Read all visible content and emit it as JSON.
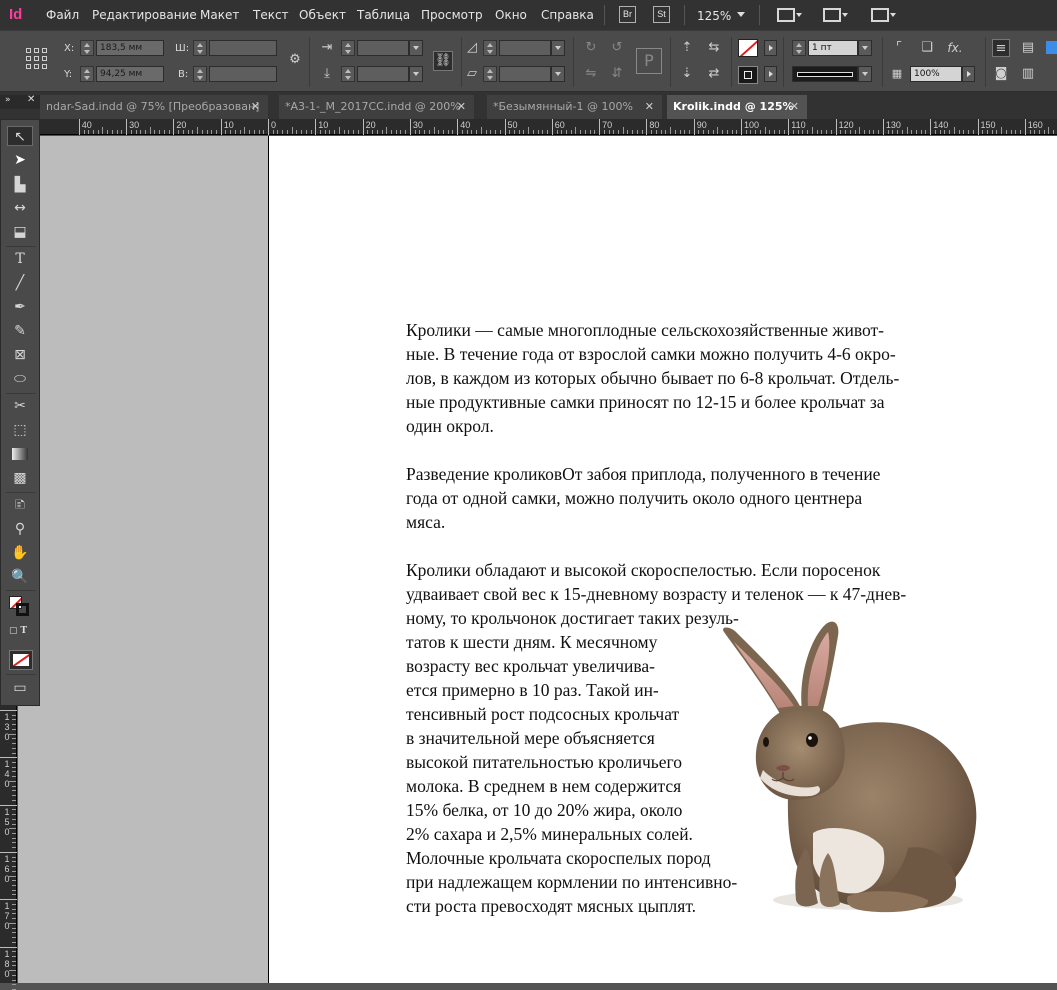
{
  "app": {
    "logo": "Id",
    "menu": [
      "Файл",
      "Редактирование",
      "Макет",
      "Текст",
      "Объект",
      "Таблица",
      "Просмотр",
      "Окно",
      "Справка"
    ],
    "bridge_label": "Br",
    "stock_label": "St",
    "zoom": "125%"
  },
  "control": {
    "x_label": "X:",
    "x_value": "183,5 мм",
    "y_label": "Y:",
    "y_value": "94,25 мм",
    "w_label": "Ш:",
    "h_label": "В:",
    "stroke_weight": "1 пт",
    "opacity": "100%",
    "fx_label": "fx."
  },
  "tabs": [
    {
      "label": "ndar-Sad.indd @ 75% [Преобразован]",
      "active": false
    },
    {
      "label": "*А3-1-_М_2017CC.indd @ 200%",
      "active": false
    },
    {
      "label": "*Безымянный-1 @ 100%",
      "active": false
    },
    {
      "label": "Krolik.indd @ 125%",
      "active": true
    }
  ],
  "ruler": {
    "horizontal": [
      "40",
      "30",
      "20",
      "10",
      "0",
      "10",
      "20",
      "30",
      "40",
      "50",
      "60",
      "70",
      "80",
      "90",
      "100",
      "110",
      "120",
      "130",
      "140",
      "150",
      "160"
    ],
    "vertical": [
      [
        "1",
        "3",
        "0"
      ],
      [
        "1",
        "4",
        "0"
      ],
      [
        "1",
        "5",
        "0"
      ],
      [
        "1",
        "6",
        "0"
      ],
      [
        "1",
        "7",
        "0"
      ],
      [
        "1",
        "8",
        "0"
      ]
    ]
  },
  "document": {
    "paragraph1": [
      "Кролики — самые многоплодные сельскохозяйственные живот-",
      "ные. В течение года от взрослой самки можно получить 4-6 окро-",
      "лов, в каждом из которых обычно бывает по 6-8 крольчат. Отдель-",
      "ные продуктивные самки приносят по 12-15 и более крольчат за",
      "один окрол."
    ],
    "paragraph2": [
      "Разведение кроликовОт забоя приплода, полученного в течение",
      "года от одной самки, можно получить около одного центнера",
      "мяса."
    ],
    "paragraph3": [
      "Кролики обладают и высокой скороспелостью. Если поросенок",
      "удваивает свой вес к 15-дневному возрасту и теленок — к 47-днев-",
      "ному, то крольчонок достигает таких резуль-",
      "татов к шести дням. К месячному",
      "возрасту вес крольчат увеличива-",
      "ется примерно в 10 раз. Такой ин-",
      "тенсивный рост подсосных крольчат",
      "в значительной мере объясняется",
      "высокой питательностью кроличьего",
      "молока. В среднем в нем содержится",
      "15% белка, от 10 до 20% жира, около",
      "2% сахара и 2,5% минеральных солей.",
      "Молочные крольчата скороспелых пород",
      "при надлежащем кормлении по интенсивно-",
      "сти роста превосходят мясных цыплят."
    ]
  },
  "colors": {
    "accent_logo": "#ff3d9a",
    "pasteboard": "#bcbcbc",
    "page": "#ffffff",
    "no_fill_red": "#e02020"
  },
  "icons": [
    "selection-icon",
    "direct-selection-icon",
    "page-tool-icon",
    "gap-tool-icon",
    "content-collector-icon",
    "type-tool-icon",
    "line-tool-icon",
    "pen-tool-icon",
    "pencil-tool-icon",
    "rectangle-frame-icon",
    "ellipse-tool-icon",
    "scissors-icon",
    "free-transform-icon",
    "gradient-swatch-icon",
    "gradient-feather-icon",
    "note-tool-icon",
    "eyedropper-icon",
    "hand-tool-icon",
    "zoom-tool-icon",
    "fill-stroke-icon",
    "screen-mode-icon"
  ]
}
